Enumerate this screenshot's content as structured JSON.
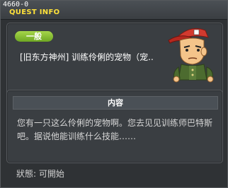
{
  "window": {
    "quest_id": "4660-0",
    "title": "QUEST INFO"
  },
  "quest": {
    "category": "一般",
    "name": "[旧东方神州] 训练伶俐的宠物（宠..",
    "npc_icon": "soldier-npc-portrait"
  },
  "content": {
    "header": "内容",
    "body": "您有一只这么伶俐的宠物啊。您去见见训练师巴特斯吧。据说他能训练什么技能……"
  },
  "status": {
    "text": "狀態:  可開始"
  },
  "colors": {
    "title": "#ffe23a",
    "badge": "#8cc33a",
    "background": "#2f3235"
  }
}
